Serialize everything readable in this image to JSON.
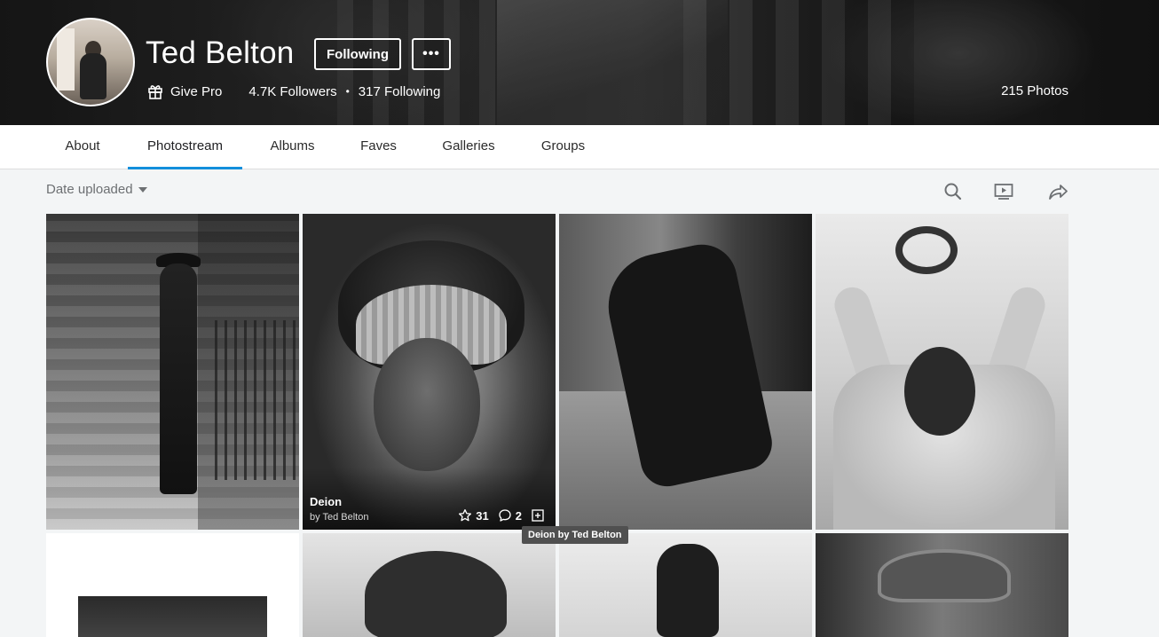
{
  "profile": {
    "name": "Ted Belton",
    "following_label": "Following",
    "more_label": "•••",
    "give_pro_label": "Give Pro",
    "followers_label": "4.7K Followers",
    "separator": "•",
    "following_count_label": "317 Following",
    "photos_count_label": "215 Photos"
  },
  "tabs": [
    {
      "label": "About"
    },
    {
      "label": "Photostream",
      "active": true
    },
    {
      "label": "Albums"
    },
    {
      "label": "Faves"
    },
    {
      "label": "Galleries"
    },
    {
      "label": "Groups"
    }
  ],
  "toolbar": {
    "sort_label": "Date uploaded",
    "icons": [
      "search-icon",
      "slideshow-icon",
      "share-icon"
    ]
  },
  "photos": [
    {
      "title": "Deion",
      "byline": "by Ted Belton",
      "faves": "31",
      "comments": "2"
    }
  ],
  "tooltip": "Deion by Ted Belton",
  "colors": {
    "accent": "#128fdc",
    "background": "#f3f5f6"
  }
}
